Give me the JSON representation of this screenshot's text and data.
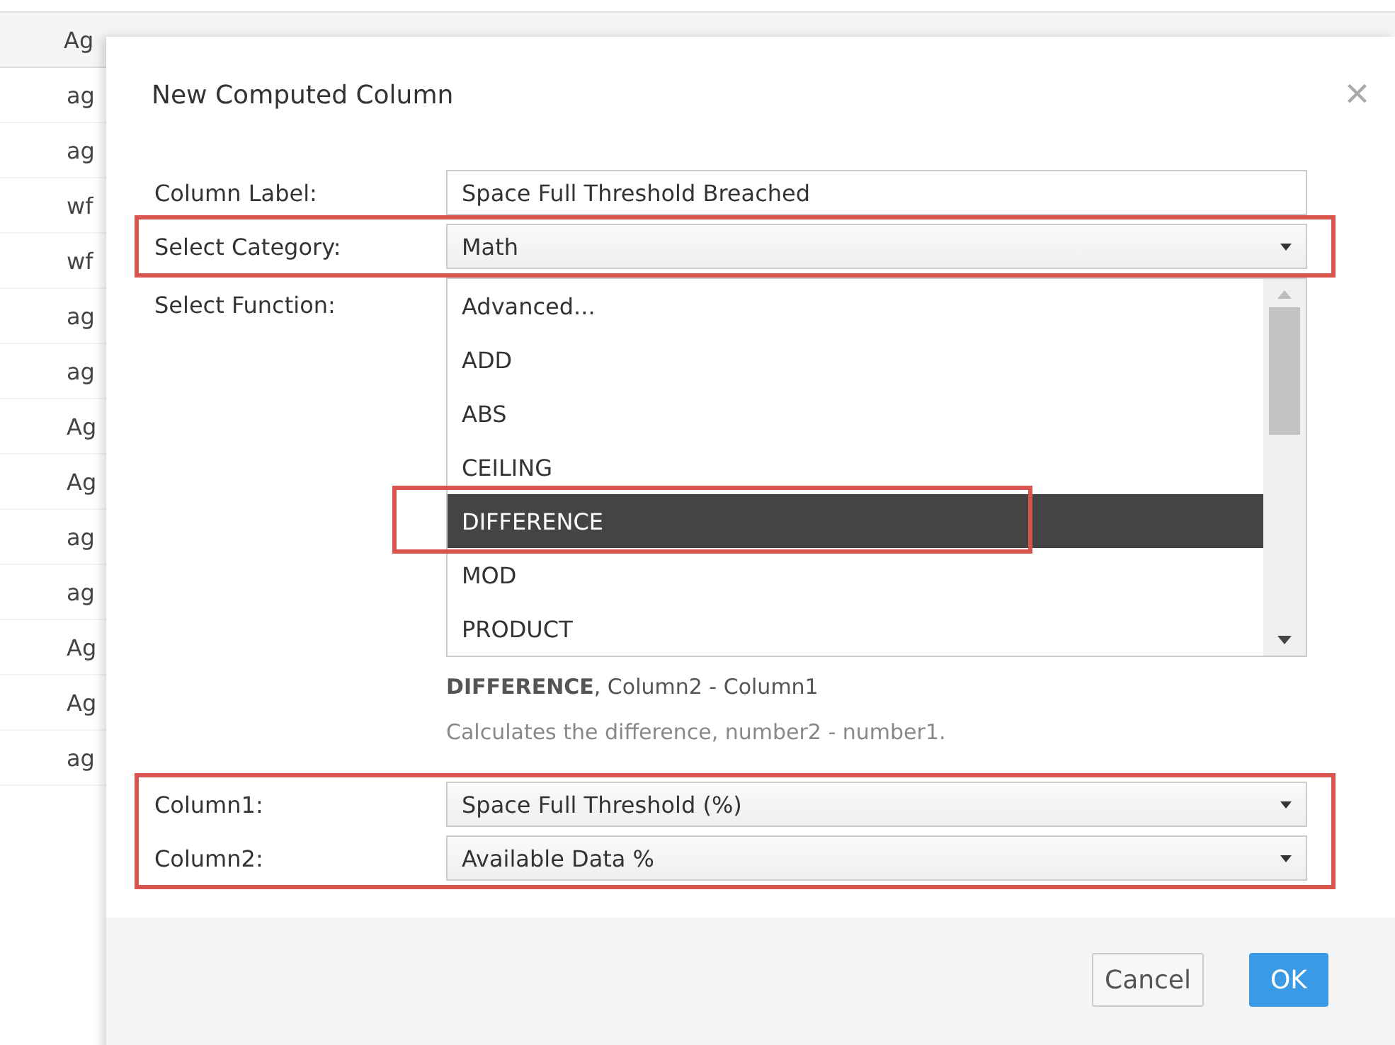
{
  "table": {
    "columns": [
      "Ag"
    ],
    "rows": [
      "ag",
      "ag",
      "wf",
      "wf",
      "ag",
      "ag",
      "Ag",
      "Ag",
      "ag",
      "ag",
      "Ag",
      "Ag",
      "ag"
    ]
  },
  "dialog": {
    "title": "New Computed Column",
    "close": "×",
    "fields": [
      {
        "kind": "text",
        "label": "Column Label:",
        "value": "Space Full Threshold Breached",
        "highlighted": false
      },
      {
        "kind": "select",
        "label": "Select Category:",
        "value": "Math",
        "highlighted": true
      }
    ],
    "function": {
      "label": "Select Function:",
      "options": [
        {
          "label": "Advanced...",
          "selected": false
        },
        {
          "label": "ADD",
          "selected": false
        },
        {
          "label": "ABS",
          "selected": false
        },
        {
          "label": "CEILING",
          "selected": false
        },
        {
          "label": "DIFFERENCE",
          "selected": true
        },
        {
          "label": "MOD",
          "selected": false
        },
        {
          "label": "PRODUCT",
          "selected": false
        }
      ],
      "syntax": "**DIFFERENCE**, Column2 - Column1",
      "description": "Calculates the difference, number2 - number1."
    },
    "columns": [
      {
        "label": "Column1:",
        "value": "Space Full Threshold (%)"
      },
      {
        "label": "Column2:",
        "value": "Available Data %"
      }
    ],
    "buttons": [
      {
        "label": "Cancel",
        "kind": "secondary"
      },
      {
        "label": "OK",
        "kind": "primary"
      }
    ]
  }
}
